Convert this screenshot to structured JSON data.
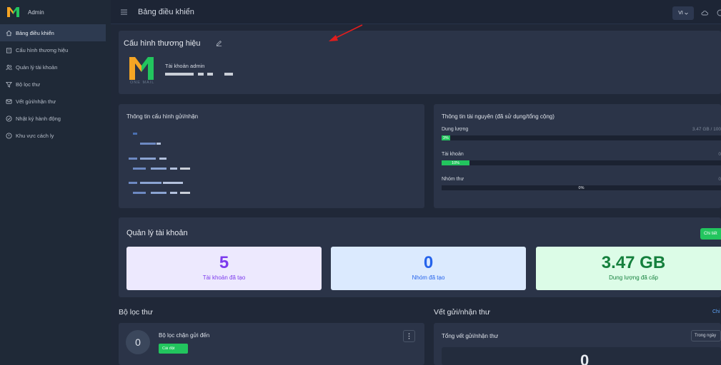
{
  "brand": {
    "label": "Admin"
  },
  "sidebar": {
    "items": [
      {
        "label": "Bảng điều khiển",
        "icon": "home-icon",
        "active": true
      },
      {
        "label": "Cấu hình thương hiệu",
        "icon": "building-icon",
        "active": false
      },
      {
        "label": "Quản lý tài khoản",
        "icon": "users-icon",
        "active": false
      },
      {
        "label": "Bộ lọc thư",
        "icon": "filter-icon",
        "active": false
      },
      {
        "label": "Vết gửi/nhận thư",
        "icon": "mail-icon",
        "active": false
      },
      {
        "label": "Nhật ký hành động",
        "icon": "activity-icon",
        "active": false
      },
      {
        "label": "Khu vực cách ly",
        "icon": "shield-icon",
        "active": false
      }
    ]
  },
  "topbar": {
    "title": "Bảng điều khiển",
    "lang": "VI"
  },
  "brand_config": {
    "title": "Cấu hình thương hiệu",
    "logo_caption": "ONE MAIL",
    "admin_label": "Tài khoản admin"
  },
  "config_info": {
    "title": "Thông tin cấu hình gửi/nhận"
  },
  "resources": {
    "title": "Thông tin tài nguyên (đã sử dụng/tổng cộng)",
    "items": [
      {
        "label": "Dung lượng",
        "value": "3.47 GB / 100",
        "percent": 3,
        "percent_label": "3%"
      },
      {
        "label": "Tài khoản",
        "value": "0",
        "percent": 10,
        "percent_label": "10%"
      },
      {
        "label": "Nhóm thư",
        "value": "0",
        "percent": 0,
        "percent_label": "0%"
      }
    ]
  },
  "accounts": {
    "title": "Quản lý tài khoản",
    "detail_label": "Chi tiết",
    "stats": [
      {
        "value": "5",
        "label": "Tài khoản đã tạo",
        "color": "#7c3aed",
        "bg": "#ede9fe"
      },
      {
        "value": "0",
        "label": "Nhóm đã tạo",
        "color": "#2563eb",
        "bg": "#dbeafe"
      },
      {
        "value": "3.47 GB",
        "label": "Dung lượng đã cấp",
        "color": "#15803d",
        "bg": "#dcfce7"
      }
    ]
  },
  "filters": {
    "title": "Bộ lọc thư",
    "item": {
      "count": "0",
      "name": "Bộ lọc chặn gửi đến",
      "tag": "Cài đặt"
    }
  },
  "traces": {
    "title": "Vết gửi/nhận thư",
    "link": "Chi",
    "card_title": "Tổng vết gửi/nhận thư",
    "period": "Trong ngày",
    "total": "0"
  },
  "colors": {
    "sidebar": "#1f2937",
    "main": "#202838",
    "card": "#2b3448",
    "accent": "#22c55e",
    "annotation": "#e11d1d"
  }
}
